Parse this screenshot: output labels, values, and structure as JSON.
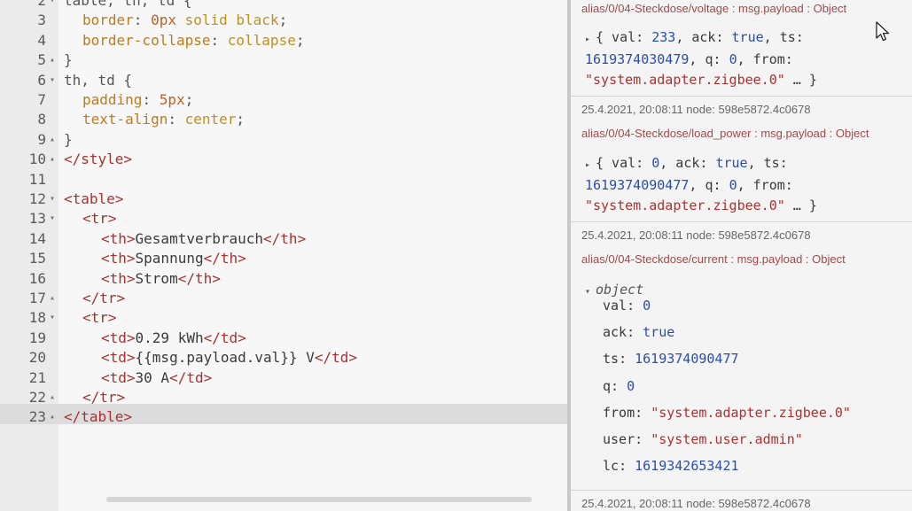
{
  "editor": {
    "lines": [
      {
        "num": "2",
        "fold": "▾",
        "tokens": [
          {
            "cls": "t-plain",
            "text": "table, th, td {"
          }
        ],
        "indent": 0
      },
      {
        "num": "3",
        "fold": "",
        "tokens": [
          {
            "cls": "t-prop",
            "text": "border"
          },
          {
            "cls": "t-plain",
            "text": ": "
          },
          {
            "cls": "t-num",
            "text": "0px"
          },
          {
            "cls": "t-val",
            "text": " solid black"
          },
          {
            "cls": "t-plain",
            "text": ";"
          }
        ],
        "indent": 1
      },
      {
        "num": "4",
        "fold": "",
        "tokens": [
          {
            "cls": "t-prop",
            "text": "border-collapse"
          },
          {
            "cls": "t-plain",
            "text": ": "
          },
          {
            "cls": "t-val",
            "text": "collapse"
          },
          {
            "cls": "t-plain",
            "text": ";"
          }
        ],
        "indent": 1
      },
      {
        "num": "5",
        "fold": "▴",
        "tokens": [
          {
            "cls": "t-plain",
            "text": "}"
          }
        ],
        "indent": 0
      },
      {
        "num": "6",
        "fold": "▾",
        "tokens": [
          {
            "cls": "t-plain",
            "text": "th, td {"
          }
        ],
        "indent": 0
      },
      {
        "num": "7",
        "fold": "",
        "tokens": [
          {
            "cls": "t-prop",
            "text": "padding"
          },
          {
            "cls": "t-plain",
            "text": ": "
          },
          {
            "cls": "t-num",
            "text": "5px"
          },
          {
            "cls": "t-plain",
            "text": ";"
          }
        ],
        "indent": 1
      },
      {
        "num": "8",
        "fold": "",
        "tokens": [
          {
            "cls": "t-prop",
            "text": "text-align"
          },
          {
            "cls": "t-plain",
            "text": ": "
          },
          {
            "cls": "t-val",
            "text": "center"
          },
          {
            "cls": "t-plain",
            "text": ";"
          }
        ],
        "indent": 1
      },
      {
        "num": "9",
        "fold": "▴",
        "tokens": [
          {
            "cls": "t-plain",
            "text": "}"
          }
        ],
        "indent": 0
      },
      {
        "num": "10",
        "fold": "▴",
        "tokens": [
          {
            "cls": "t-tag",
            "text": "</style>"
          }
        ],
        "indent": 0
      },
      {
        "num": "11",
        "fold": "",
        "tokens": [],
        "indent": 0
      },
      {
        "num": "12",
        "fold": "▾",
        "tokens": [
          {
            "cls": "t-tag",
            "text": "<table>"
          }
        ],
        "indent": 0
      },
      {
        "num": "13",
        "fold": "▾",
        "tokens": [
          {
            "cls": "t-tag",
            "text": "<tr>"
          }
        ],
        "indent": 1
      },
      {
        "num": "14",
        "fold": "",
        "tokens": [
          {
            "cls": "t-tag",
            "text": "<th>"
          },
          {
            "cls": "t-text",
            "text": "Gesamtverbrauch"
          },
          {
            "cls": "t-tag",
            "text": "</th>"
          }
        ],
        "indent": 2
      },
      {
        "num": "15",
        "fold": "",
        "tokens": [
          {
            "cls": "t-tag",
            "text": "<th>"
          },
          {
            "cls": "t-text",
            "text": "Spannung"
          },
          {
            "cls": "t-tag",
            "text": "</th>"
          }
        ],
        "indent": 2
      },
      {
        "num": "16",
        "fold": "",
        "tokens": [
          {
            "cls": "t-tag",
            "text": "<th>"
          },
          {
            "cls": "t-text",
            "text": "Strom"
          },
          {
            "cls": "t-tag",
            "text": "</th>"
          }
        ],
        "indent": 2
      },
      {
        "num": "17",
        "fold": "▴",
        "tokens": [
          {
            "cls": "t-tag",
            "text": "</tr>"
          }
        ],
        "indent": 1
      },
      {
        "num": "18",
        "fold": "▾",
        "tokens": [
          {
            "cls": "t-tag",
            "text": "<tr>"
          }
        ],
        "indent": 1
      },
      {
        "num": "19",
        "fold": "",
        "tokens": [
          {
            "cls": "t-tag",
            "text": "<td>"
          },
          {
            "cls": "t-text",
            "text": "0.29 kWh"
          },
          {
            "cls": "t-tag",
            "text": "</td>"
          }
        ],
        "indent": 2
      },
      {
        "num": "20",
        "fold": "",
        "tokens": [
          {
            "cls": "t-tag",
            "text": "<td>"
          },
          {
            "cls": "t-text",
            "text": "{{msg.payload.val}} V"
          },
          {
            "cls": "t-tag",
            "text": "</td>"
          }
        ],
        "indent": 2
      },
      {
        "num": "21",
        "fold": "",
        "tokens": [
          {
            "cls": "t-tag",
            "text": "<td>"
          },
          {
            "cls": "t-text",
            "text": "30 A"
          },
          {
            "cls": "t-tag",
            "text": "</td>"
          }
        ],
        "indent": 2
      },
      {
        "num": "22",
        "fold": "▴",
        "tokens": [
          {
            "cls": "t-tag",
            "text": "</tr>"
          }
        ],
        "indent": 1
      },
      {
        "num": "23",
        "fold": "▴",
        "tokens": [
          {
            "cls": "t-tag",
            "text": "</table>"
          }
        ],
        "indent": 0
      }
    ]
  },
  "debug": {
    "messages": [
      {
        "topic": "alias/0/04-Steckdose/voltage : msg.payload : Object",
        "payload_lines": [
          [
            {
              "c": "k",
              "t": "{ val: "
            },
            {
              "c": "num",
              "t": "233"
            },
            {
              "c": "k",
              "t": ", ack: "
            },
            {
              "c": "bool",
              "t": "true"
            },
            {
              "c": "k",
              "t": ", ts:"
            }
          ],
          [
            {
              "c": "num",
              "t": "1619374030479"
            },
            {
              "c": "k",
              "t": ", q: "
            },
            {
              "c": "num",
              "t": "0"
            },
            {
              "c": "k",
              "t": ", from:"
            }
          ],
          [
            {
              "c": "str",
              "t": "\"system.adapter.zigbee.0\""
            },
            {
              "c": "k",
              "t": " … }"
            }
          ]
        ]
      },
      {
        "meta": "25.4.2021, 20:08:11   node: 598e5872.4c0678",
        "topic": "alias/0/04-Steckdose/load_power : msg.payload : Object",
        "payload_lines": [
          [
            {
              "c": "k",
              "t": "{ val: "
            },
            {
              "c": "num",
              "t": "0"
            },
            {
              "c": "k",
              "t": ", ack: "
            },
            {
              "c": "bool",
              "t": "true"
            },
            {
              "c": "k",
              "t": ", ts:"
            }
          ],
          [
            {
              "c": "num",
              "t": "1619374090477"
            },
            {
              "c": "k",
              "t": ", q: "
            },
            {
              "c": "num",
              "t": "0"
            },
            {
              "c": "k",
              "t": ", from:"
            }
          ],
          [
            {
              "c": "str",
              "t": "\"system.adapter.zigbee.0\""
            },
            {
              "c": "k",
              "t": " … }"
            }
          ]
        ]
      },
      {
        "meta": "25.4.2021, 20:08:11   node: 598e5872.4c0678",
        "topic": "alias/0/04-Steckdose/current : msg.payload : Object",
        "object_label": "object",
        "props": [
          {
            "key": "val",
            "value": "0",
            "type": "num"
          },
          {
            "key": "ack",
            "value": "true",
            "type": "bool"
          },
          {
            "key": "ts",
            "value": "1619374090477",
            "type": "num"
          },
          {
            "key": "q",
            "value": "0",
            "type": "num"
          },
          {
            "key": "from",
            "value": "\"system.adapter.zigbee.0\"",
            "type": "str"
          },
          {
            "key": "user",
            "value": "\"system.user.admin\"",
            "type": "str"
          },
          {
            "key": "lc",
            "value": "1619342653421",
            "type": "num"
          }
        ]
      },
      {
        "meta": "25.4.2021, 20:08:11   node: 598e5872.4c0678"
      }
    ]
  }
}
